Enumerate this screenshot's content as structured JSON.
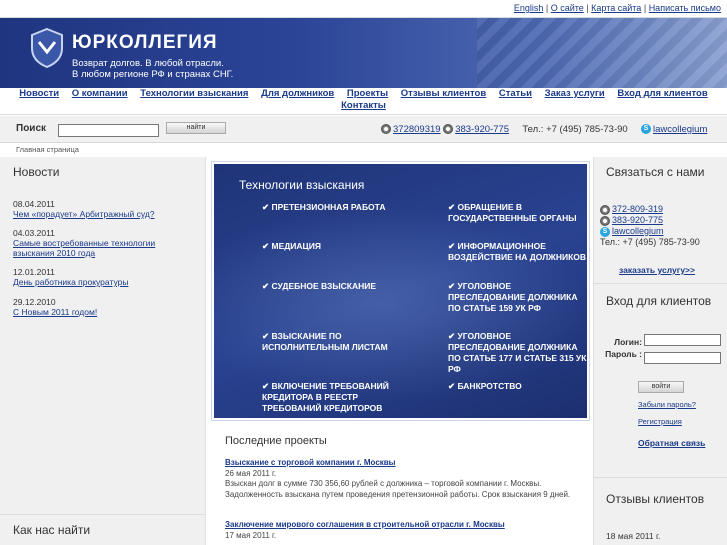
{
  "top_links": {
    "english": "English",
    "about": "О сайте",
    "sitemap": "Карта сайта",
    "write": "Написать письмо",
    "sep": "|"
  },
  "header": {
    "brand": "ЮРКОЛЛЕГИЯ",
    "slogan1": "Возврат долгов. В любой отрасли.",
    "slogan2": "В любом регионе РФ и странах СНГ."
  },
  "nav": {
    "row1": [
      "Новости",
      "О компании",
      "Технологии взыскания",
      "Для должников",
      "Проекты",
      "Отзывы клиентов",
      "Статьи",
      "Заказ услуги",
      "Вход для клиентов"
    ],
    "row2": [
      "Контакты"
    ]
  },
  "search": {
    "label": "Поиск",
    "button": "найти",
    "value": ""
  },
  "phones": {
    "icq1": "372809319",
    "icq2": "383-920-775",
    "tel": "Тел.: +7 (495) 785-73-90",
    "skype": "lawcollegium"
  },
  "breadcrumb": "Главная страница",
  "news": {
    "title": "Новости",
    "items": [
      {
        "date": "08.04.2011",
        "text": "Чем «порадует» Арбитражный суд?"
      },
      {
        "date": "04.03.2011",
        "text": "Самые востребованные технологии взыскания 2010 года"
      },
      {
        "date": "12.01.2011",
        "text": "День работника прокуратуры"
      },
      {
        "date": "29.12.2010",
        "text": "С Новым 2011 годом!"
      }
    ]
  },
  "find_us": "Как нас найти",
  "tech": {
    "title": "Технологии взыскания",
    "items": [
      "Претензионная работа",
      "Обращение в государственные органы",
      "Медиация",
      "Информационное воздействие на должников",
      "Судебное взыскание",
      "Уголовное преследование должника по статье 159 УК РФ",
      "Взыскание по исполнительным листам",
      "Уголовное преследование должника по статье 177 и статье 315 УК РФ",
      "Включение требований кредитора в реестр требований кредиторов",
      "Банкротство"
    ],
    "check": "✔"
  },
  "projects": {
    "title": "Последние проекты",
    "items": [
      {
        "title": "Взыскание с торговой компании г. Москвы",
        "date": "26 мая 2011 г.",
        "text": "Взыскан долг в сумме 730 356,60 рублей с должника – торговой компании г. Москвы. Задолженность взыскана путем проведения претензионной работы. Срок взыскания 9 дней."
      },
      {
        "title": "Заключение мирового соглашения в строительной отрасли г. Москвы",
        "date": "17 мая 2011 г.",
        "text": ""
      }
    ]
  },
  "contact": {
    "title": "Связаться с нами",
    "icq1": "372-809-319",
    "icq2": "383-920-775",
    "skype": "lawcollegium",
    "tel": "Тел.: +7 (495) 785-73-90",
    "order": "заказать услугу>>"
  },
  "login": {
    "title": "Вход для клиентов",
    "login_label": "Логин:",
    "pass_label": "Пароль :",
    "button": "войти",
    "forgot": "Забыли пароль?",
    "register": "Регистрация",
    "feedback": "Обратная связь"
  },
  "reviews": {
    "title": "Отзывы клиентов",
    "date": "18 мая 2011 г."
  }
}
